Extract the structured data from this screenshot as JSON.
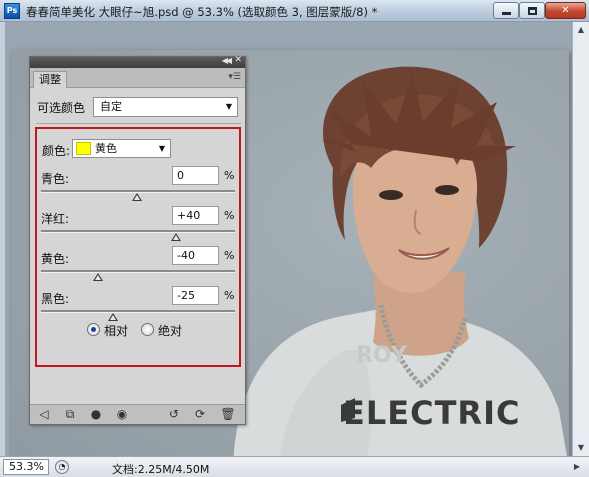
{
  "window": {
    "title": "春春简单美化  大眼仔~旭.psd @ 53.3% (选取颜色 3, 图层蒙版/8) *",
    "app_icon": "Ps",
    "minimize_icon": "minimize-icon",
    "maximize_icon": "maximize-icon",
    "close_icon": "close-icon"
  },
  "panel": {
    "tab_label": "调整",
    "menu_icon": "panel-menu-icon",
    "preset": {
      "label": "可选颜色",
      "value": "自定"
    },
    "colors": {
      "label": "颜色:",
      "value": "黄色",
      "swatch": "#ffff00"
    },
    "sliders": [
      {
        "label": "青色:",
        "value": "0",
        "unit": "%",
        "level": 0
      },
      {
        "label": "洋红:",
        "value": "+40",
        "unit": "%",
        "level": 40
      },
      {
        "label": "黄色:",
        "value": "-40",
        "unit": "%",
        "level": -40
      },
      {
        "label": "黑色:",
        "value": "-25",
        "unit": "%",
        "level": -25
      }
    ],
    "method": {
      "options": [
        {
          "label": "相对",
          "selected": true
        },
        {
          "label": "绝对",
          "selected": false
        }
      ]
    },
    "footer_icons": [
      "back-arrow-icon",
      "clip-layer-icon",
      "visibility-mask-icon",
      "eye-icon",
      "view-previous-icon",
      "reset-icon",
      "trash-icon"
    ]
  },
  "status": {
    "zoom": "53.3%",
    "doc_info": "文档:2.25M/4.50M"
  },
  "colors": {
    "highlight_frame": "#c1161f",
    "selected_radio": "#1d3f9e"
  }
}
